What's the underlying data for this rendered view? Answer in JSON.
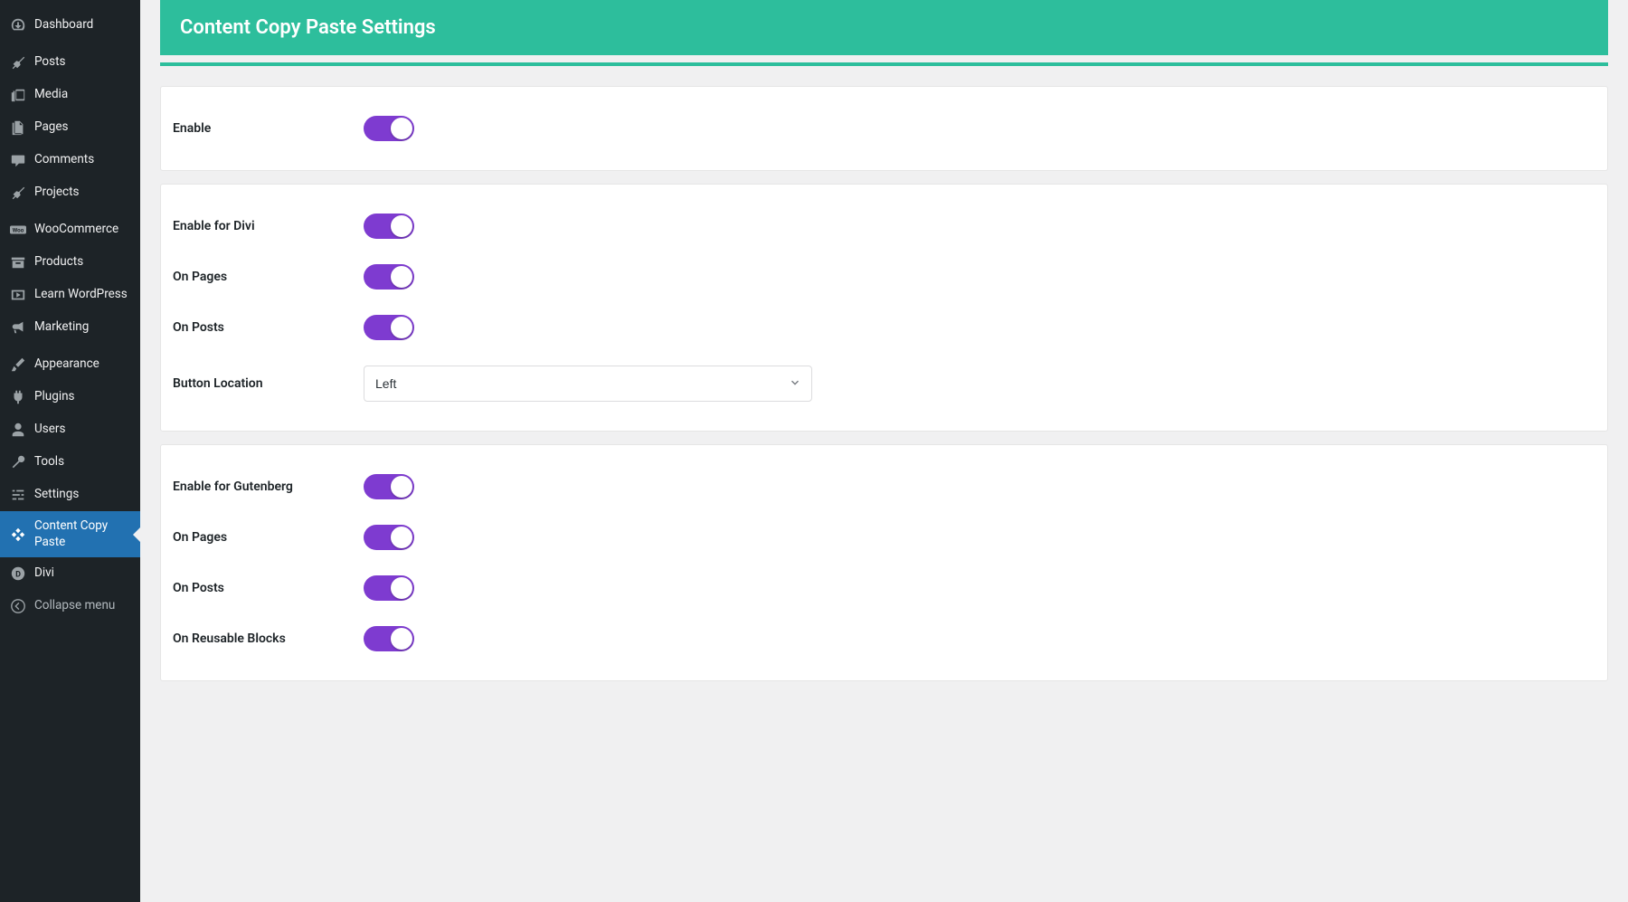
{
  "sidebar": {
    "items": [
      {
        "label": "Dashboard"
      },
      {
        "label": "Posts"
      },
      {
        "label": "Media"
      },
      {
        "label": "Pages"
      },
      {
        "label": "Comments"
      },
      {
        "label": "Projects"
      },
      {
        "label": "WooCommerce"
      },
      {
        "label": "Products"
      },
      {
        "label": "Learn WordPress"
      },
      {
        "label": "Marketing"
      },
      {
        "label": "Appearance"
      },
      {
        "label": "Plugins"
      },
      {
        "label": "Users"
      },
      {
        "label": "Tools"
      },
      {
        "label": "Settings"
      },
      {
        "label": "Content Copy Paste"
      },
      {
        "label": "Divi"
      },
      {
        "label": "Collapse menu"
      }
    ]
  },
  "header": {
    "title": "Content Copy Paste Settings"
  },
  "panels": {
    "enable": {
      "label": "Enable"
    },
    "divi": {
      "enable_label": "Enable for Divi",
      "on_pages_label": "On Pages",
      "on_posts_label": "On Posts",
      "button_location_label": "Button Location",
      "button_location_value": "Left"
    },
    "gutenberg": {
      "enable_label": "Enable for Gutenberg",
      "on_pages_label": "On Pages",
      "on_posts_label": "On Posts",
      "on_reusable_label": "On Reusable Blocks"
    }
  }
}
